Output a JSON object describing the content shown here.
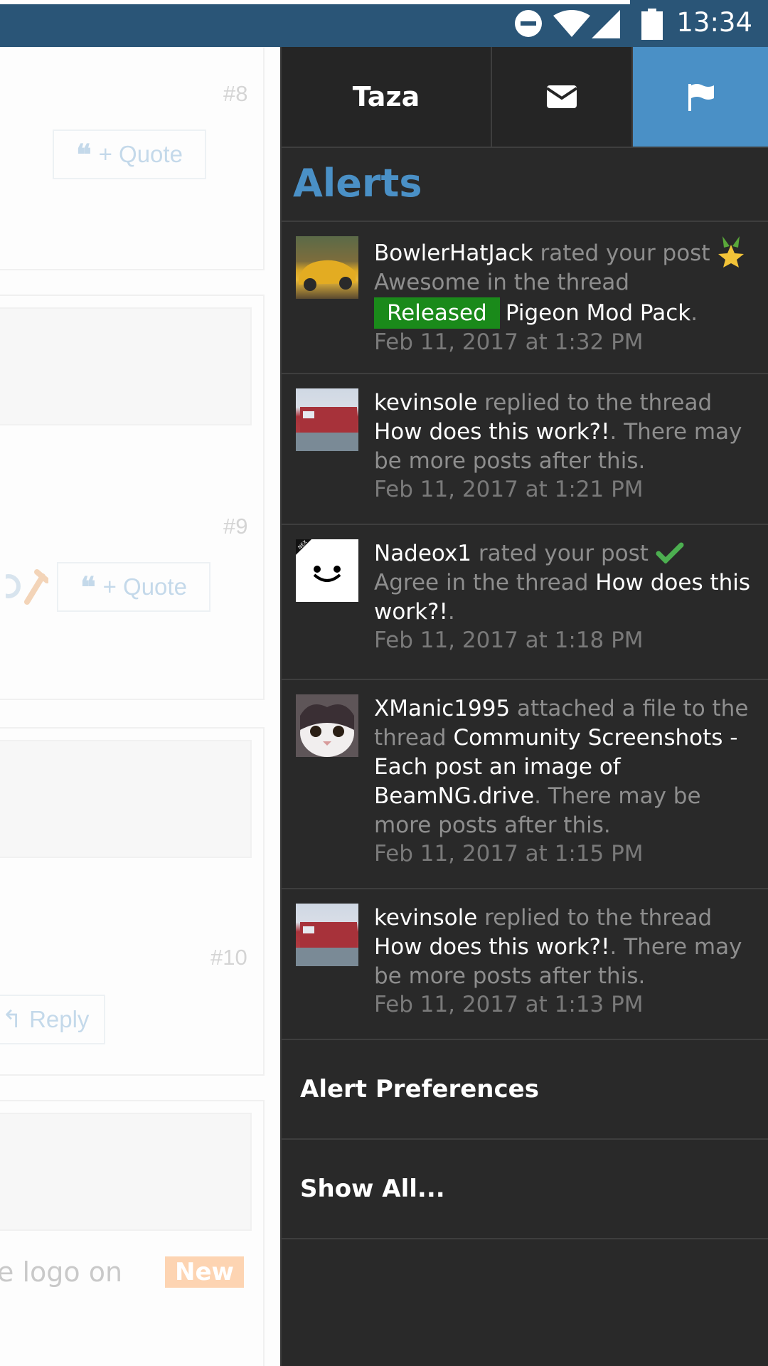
{
  "status_bar": {
    "time": "13:34",
    "icons": [
      "do-not-disturb-icon",
      "wifi-icon",
      "cell-signal-icon",
      "battery-icon"
    ]
  },
  "background_page": {
    "posts": [
      {
        "number": "#8",
        "button_label": "+ Quote"
      },
      {
        "number": "#9",
        "button_label": "+ Quote"
      },
      {
        "number": "#10",
        "button_label": "Reply"
      }
    ],
    "trailing_text": "e logo on",
    "new_badge": "New"
  },
  "drawer": {
    "tabs": {
      "user": "Taza",
      "messages_icon": "envelope-icon",
      "alerts_icon": "flag-icon"
    },
    "section_title": "Alerts",
    "alerts": [
      {
        "user": "BowlerHatJack",
        "action": " rated your post ",
        "rating": "Awesome",
        "middle": " in the thread ",
        "prefix": "Released",
        "thread": "Pigeon Mod Pack",
        "suffix": ".",
        "time": "Feb 11, 2017 at 1:32 PM",
        "avatar": "yellow-car-avatar",
        "icon": "star-medal-icon"
      },
      {
        "user": "kevinsole",
        "action": " replied to the thread ",
        "thread": "How does this work?!",
        "suffix": ". There may be more posts after this.",
        "time": "Feb 11, 2017 at 1:21 PM",
        "avatar": "train-avatar"
      },
      {
        "user": "Nadeox1",
        "action": " rated your post ",
        "rating": "Agree",
        "middle": " in the thread ",
        "thread": "How does this work?!",
        "suffix": ".",
        "time": "Feb 11, 2017 at 1:18 PM",
        "avatar": "smiley-avatar",
        "avatar_tag": "NEX",
        "icon": "check-icon"
      },
      {
        "user": "XManic1995",
        "action": " attached a file to the thread ",
        "thread": "Community Screenshots - Each post an image of BeamNG.drive",
        "suffix": ". There may be more posts after this.",
        "time": "Feb 11, 2017 at 1:15 PM",
        "avatar": "cat-avatar"
      },
      {
        "user": "kevinsole",
        "action": " replied to the thread ",
        "thread": "How does this work?!",
        "suffix": ". There may be more posts after this.",
        "time": "Feb 11, 2017 at 1:13 PM",
        "avatar": "train-avatar"
      }
    ],
    "menu": {
      "preferences": "Alert Preferences",
      "show_all": "Show All..."
    }
  },
  "colors": {
    "status_bar": "#2a5577",
    "drawer_bg": "#292929",
    "accent": "#4a90c6",
    "prefix_green": "#1a8a1a"
  }
}
